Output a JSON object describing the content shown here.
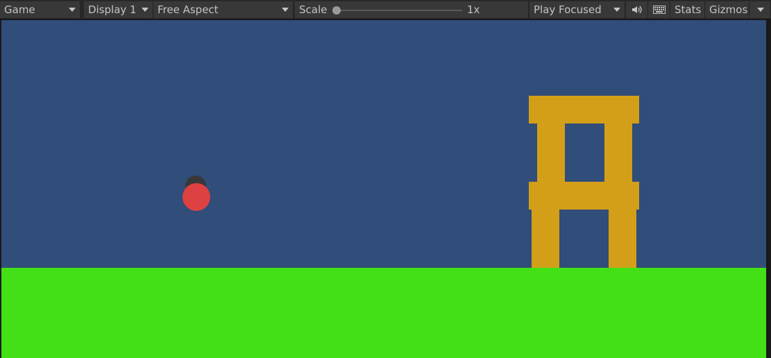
{
  "toolbar": {
    "view_label": "Game",
    "display_label": "Display 1",
    "aspect_label": "Free Aspect",
    "scale_label": "Scale",
    "scale_value": "1x",
    "play_mode_label": "Play Focused",
    "stats_label": "Stats",
    "gizmos_label": "Gizmos",
    "scale_slider_fraction": 0.0
  },
  "scene": {
    "sky_color": "#314d79",
    "ground_color": "#43e017",
    "plank_color": "#d49f18",
    "ball_color": "#de4141",
    "ball_shadow_color": "#383838"
  },
  "icons": {
    "audio": "speaker-icon",
    "keyboard": "keyboard-icon"
  }
}
